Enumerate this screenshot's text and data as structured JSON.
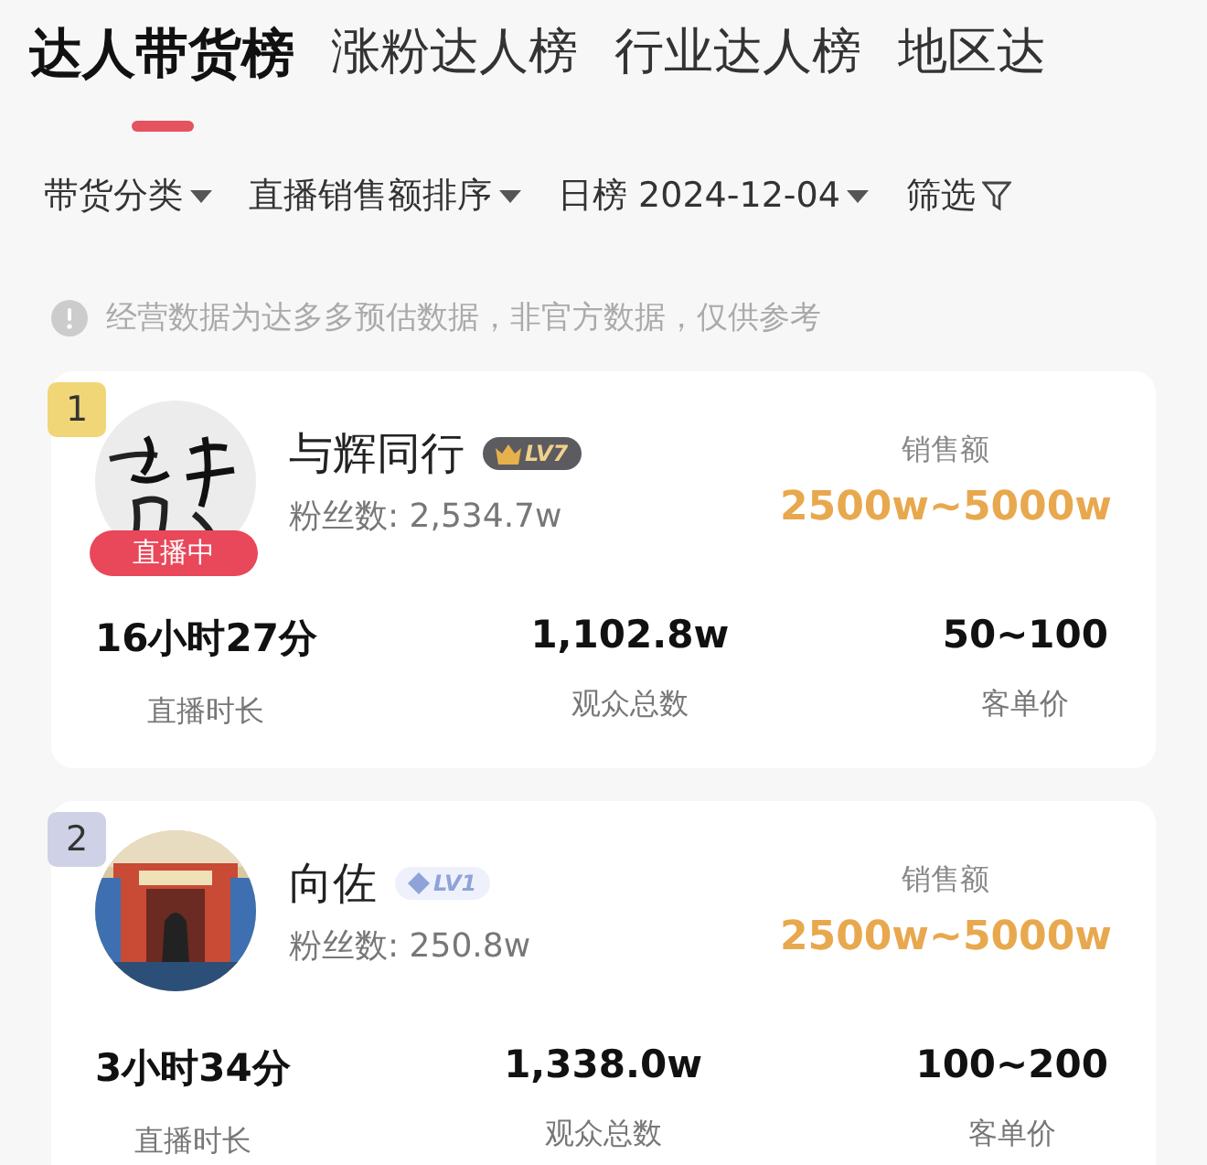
{
  "tabs": [
    {
      "label": "达人带货榜",
      "selected": true
    },
    {
      "label": "涨粉达人榜",
      "selected": false
    },
    {
      "label": "行业达人榜",
      "selected": false
    },
    {
      "label": "地区达",
      "selected": false
    }
  ],
  "filters": [
    {
      "label": "带货分类",
      "kind": "dropdown"
    },
    {
      "label": "直播销售额排序",
      "kind": "dropdown"
    },
    {
      "label": "日榜 2024-12-04",
      "kind": "dropdown"
    },
    {
      "label": "筛选",
      "kind": "filter"
    }
  ],
  "notice": "经营数据为达多多预估数据，非官方数据，仅供参考",
  "cards": [
    {
      "rank": "1",
      "color": "#f1d678",
      "live": true,
      "live_label": "直播中",
      "name": "与辉同行",
      "badge": {
        "kind": "crown",
        "text": "LV7"
      },
      "fans": "粉丝数: 2,534.7w",
      "sales_label": "销售额",
      "sales": "2500w~5000w",
      "stats": [
        {
          "value": "16小时27分",
          "label": "直播时长"
        },
        {
          "value": "1,102.8w",
          "label": "观众总数"
        },
        {
          "value": "50~100",
          "label": "客单价"
        }
      ]
    },
    {
      "rank": "2",
      "color": "#cfd1e6",
      "live": false,
      "name": "向佐",
      "badge": {
        "kind": "diamond",
        "text": "LV1"
      },
      "fans": "粉丝数: 250.8w",
      "sales_label": "销售额",
      "sales": "2500w~5000w",
      "stats": [
        {
          "value": "3小时34分",
          "label": "直播时长"
        },
        {
          "value": "1,338.0w",
          "label": "观众总数"
        },
        {
          "value": "100~200",
          "label": "客单价"
        }
      ]
    }
  ]
}
